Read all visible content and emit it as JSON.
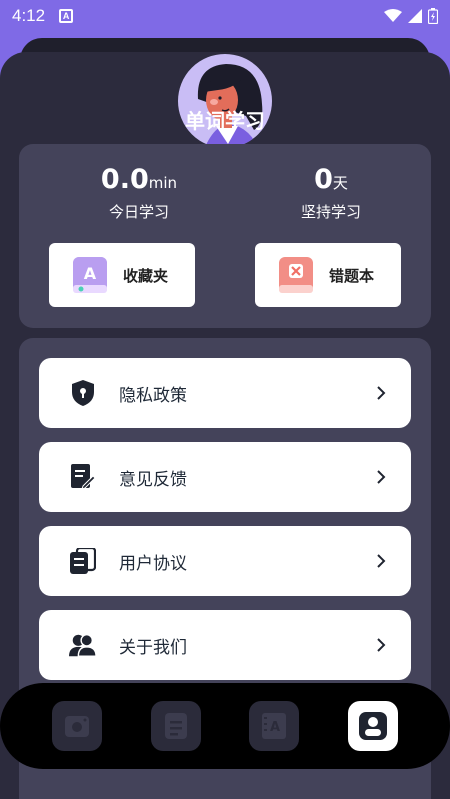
{
  "status_bar": {
    "time": "4:12",
    "notification_icon": "a-icon",
    "icons": [
      "wifi-icon",
      "signal-icon",
      "battery-icon"
    ]
  },
  "app": {
    "title": "单词学习"
  },
  "stats": [
    {
      "value": "0.0",
      "unit": "min",
      "label": "今日学习"
    },
    {
      "value": "0",
      "unit": "天",
      "label": "坚持学习"
    }
  ],
  "quick_actions": [
    {
      "label": "收藏夹",
      "icon": "favorites-book-icon"
    },
    {
      "label": "错题本",
      "icon": "wrong-answers-book-icon"
    }
  ],
  "menu": [
    {
      "label": "隐私政策",
      "icon": "shield-lock-icon"
    },
    {
      "label": "意见反馈",
      "icon": "feedback-edit-icon"
    },
    {
      "label": "用户协议",
      "icon": "document-stack-icon"
    },
    {
      "label": "关于我们",
      "icon": "users-icon"
    }
  ],
  "tabbar": {
    "tabs": [
      {
        "icon": "camera-icon",
        "active": false
      },
      {
        "icon": "list-icon",
        "active": false
      },
      {
        "icon": "dictionary-icon",
        "active": false
      },
      {
        "icon": "profile-icon",
        "active": true
      }
    ]
  },
  "colors": {
    "accent": "#7f6ae6",
    "sheet": "#2c2b3d",
    "card": "#44435a",
    "tab_bar": "#000000"
  }
}
